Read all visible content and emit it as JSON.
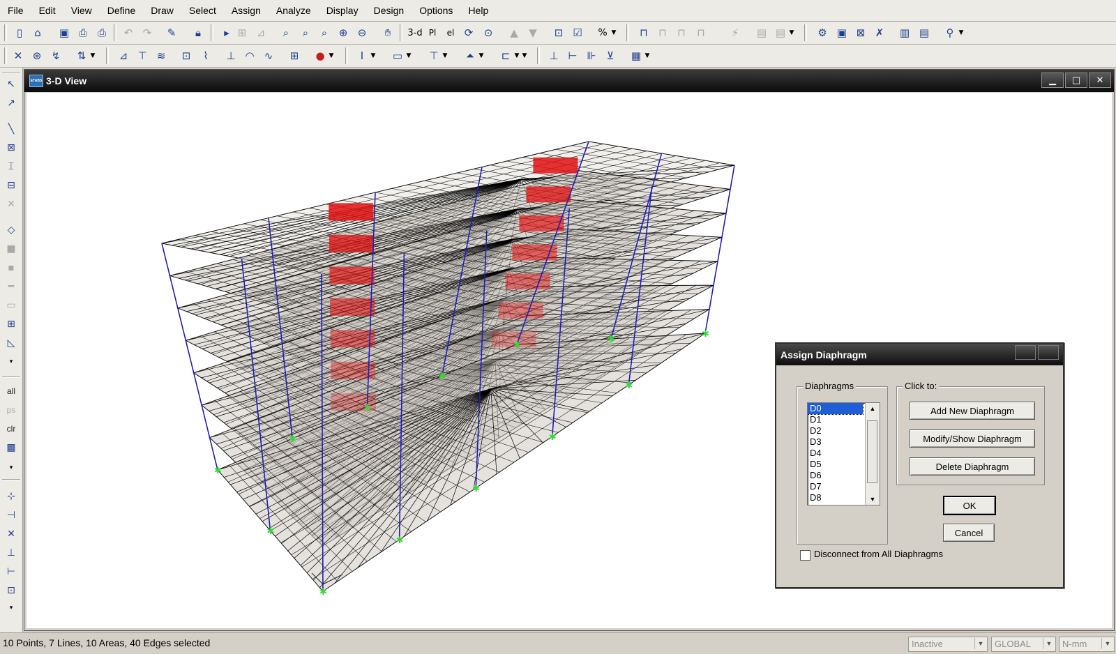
{
  "menu": [
    "File",
    "Edit",
    "View",
    "Define",
    "Draw",
    "Select",
    "Assign",
    "Analyze",
    "Display",
    "Design",
    "Options",
    "Help"
  ],
  "window": {
    "title": "3-D View",
    "icon_text": "ETABS"
  },
  "toolbar": {
    "view_3d_label": "3-d",
    "plan_label": "Pl",
    "elevation_label": "el",
    "toggle_percent_label": "%"
  },
  "left_toolbar": {
    "select_all_label": "all",
    "prev_select_label": "ps",
    "clear_select_label": "clr"
  },
  "dialog": {
    "title": "Assign Diaphragm",
    "diaphragms_group": "Diaphragms",
    "click_to_group": "Click to:",
    "diaphragms": [
      "D0",
      "D1",
      "D2",
      "D3",
      "D4",
      "D5",
      "D6",
      "D7",
      "D8"
    ],
    "selected": "D0",
    "add_button": "Add New Diaphragm",
    "modify_button": "Modify/Show Diaphragm",
    "delete_button": "Delete Diaphragm",
    "ok_button": "OK",
    "cancel_button": "Cancel",
    "disconnect_label": "Disconnect from All Diaphragms",
    "disconnect_checked": false
  },
  "status": {
    "selection_text": "10 Points, 7 Lines, 10 Areas, 40 Edges selected",
    "state": "Inactive",
    "coord_system": "GLOBAL",
    "units": "N-mm"
  },
  "colors": {
    "column": "#1f1fb8",
    "core": "#e01010",
    "support": "#36d836",
    "title_bar": "#0b0b0b"
  }
}
